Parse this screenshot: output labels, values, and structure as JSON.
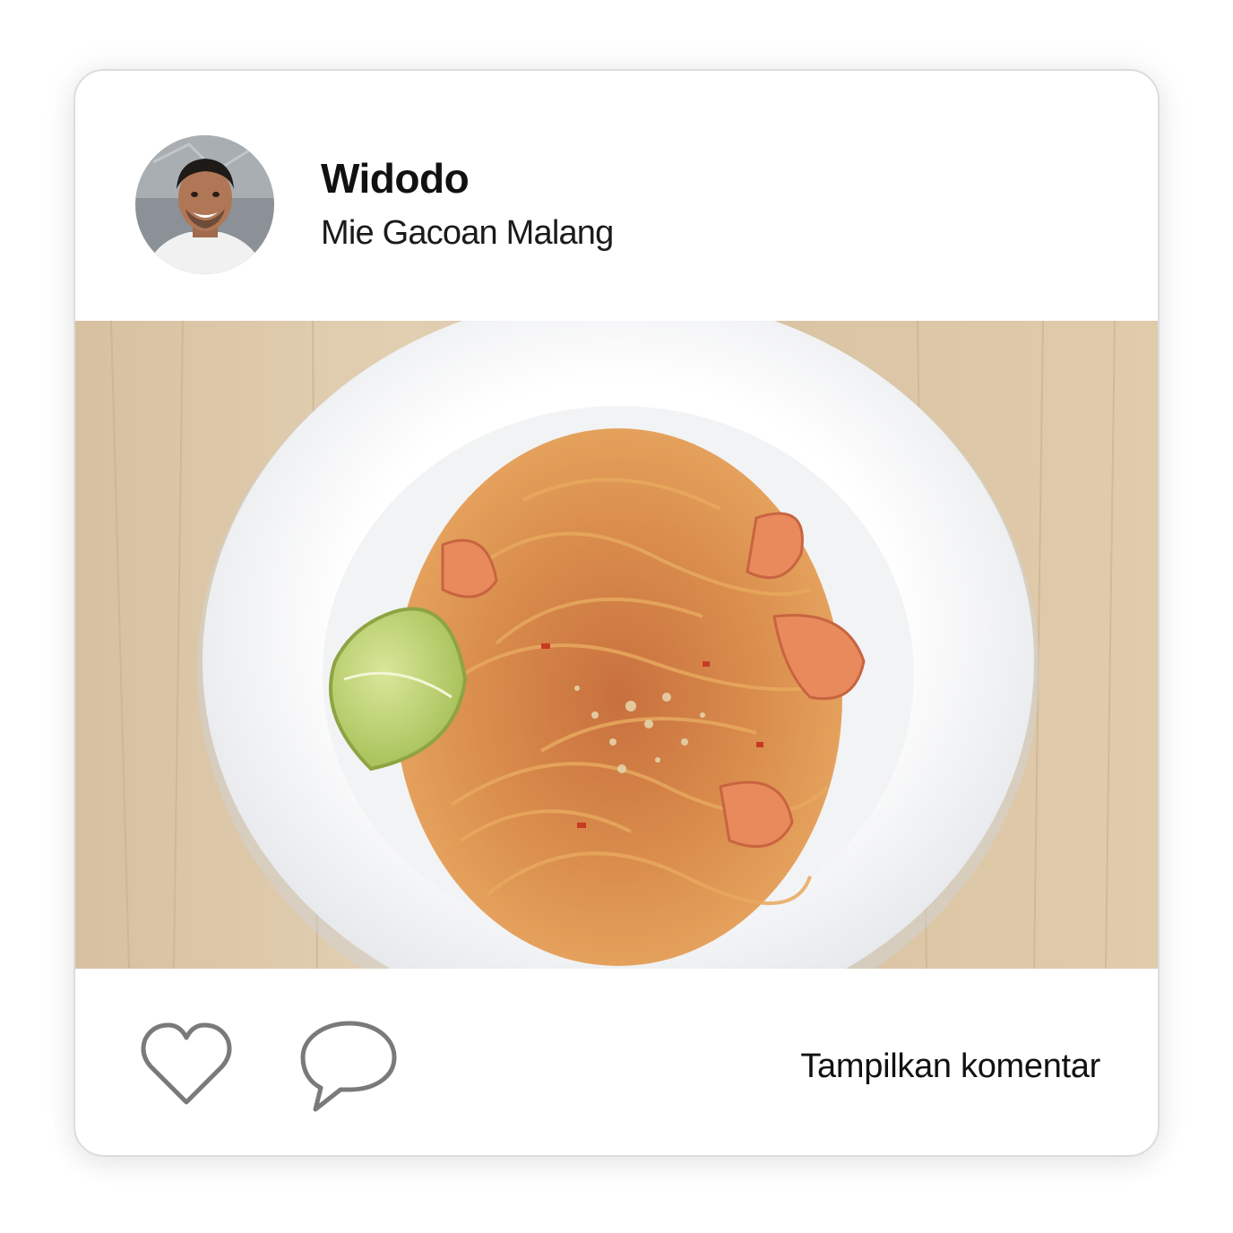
{
  "post": {
    "author": {
      "name": "Widodo",
      "avatar_icon": "user-avatar-photo"
    },
    "location": "Mie Gacoan Malang",
    "photo": {
      "subject": "food-photo"
    },
    "actions": {
      "like_icon": "heart-icon",
      "comment_icon": "comment-bubble-icon",
      "show_comments_label": "Tampilkan komentar"
    }
  },
  "colors": {
    "card_border": "#dcdcdc",
    "icon_stroke": "#7a7a7a",
    "text_primary": "#111111"
  }
}
